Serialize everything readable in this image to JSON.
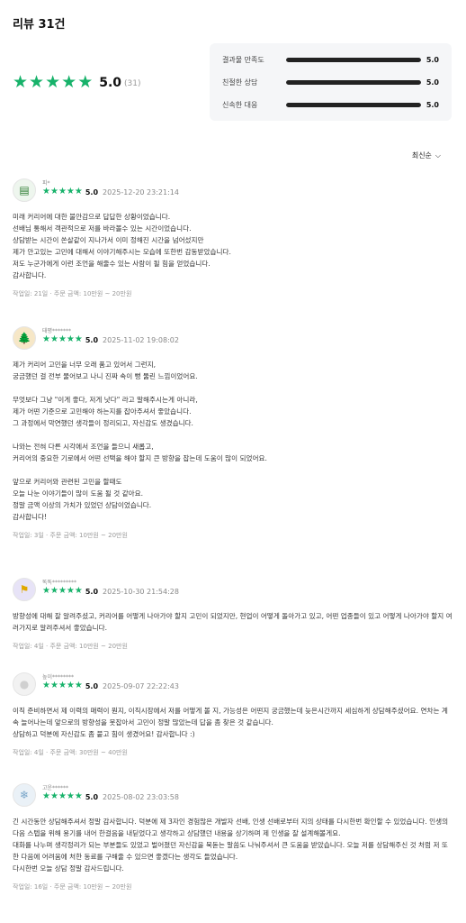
{
  "page": {
    "title": "리뷰 31건",
    "sort_label": "최신순"
  },
  "summary": {
    "rating": "5.0",
    "count": "(31)",
    "stars": 5
  },
  "breakdown": [
    {
      "label": "결과물 만족도",
      "value": "5.0",
      "fraction": 1.0
    },
    {
      "label": "친절한 상담",
      "value": "5.0",
      "fraction": 1.0
    },
    {
      "label": "신속한 대응",
      "value": "5.0",
      "fraction": 1.0
    }
  ],
  "reviews": [
    {
      "nickname": "피*",
      "avatar_icon": "card-icon",
      "score": "5.0",
      "date": "2025-12-20 23:21:14",
      "body": [
        "미래 커리어에 대한 불안감으로 답답한 상황이었습니다.",
        "선배님 통해서 객관적으로 저를 바라볼수 있는 시간이었습니다.",
        "상담받는 시간이 쏜살같이 지나가서 이미 정해진 시간을 넘어섰지만",
        "제가 안고있는 고민에 대해서 이야기해주시는 모습에 또한번 감동받았습니다.",
        "저도 누군가에게 이런 조언을 해줄수 있는 사람이 될 힘을 얻었습니다.",
        "감사합니다."
      ],
      "footer": "작업일: 21일 · 주문 금액: 10만원 ~ 20만원"
    },
    {
      "nickname": "태평*******",
      "avatar_icon": "tree-icon",
      "score": "5.0",
      "date": "2025-11-02 19:08:02",
      "body": [
        "제가 커리어 고민을 너무 오래 품고 있어서 그런지,",
        "궁금했던 걸 전부 물어보고 나니 진짜 속이 뻥 뚫린 느낌이었어요.",
        "",
        "무엇보다 그냥 \"이게 좋다, 저게 낫다\" 라고 말해주시는게 아니라,",
        "제가 어떤 기준으로 고민해야 하는지를 잡아주셔서 좋았습니다.",
        "그 과정에서 막연했던 생각들이 정리되고, 자신감도 생겼습니다.",
        "",
        "나와는 전혀 다른 시각에서 조언을 들으니 새롭고,",
        "커리어의 중요한 기로에서 어떤 선택을 해야 할지 큰 방향을 잡는데 도움이 많이 되었어요.",
        "",
        "앞으로 커리어와 관련된 고민을 할때도",
        "오늘 나눈 이야기들이 많이 도움 될 것 같아요.",
        "정말 금액 이상의 가치가 있었던 상담이었습니다.",
        "감사합니다!"
      ],
      "footer": "작업일: 3일 · 주문 금액: 10만원 ~ 20만원"
    },
    {
      "nickname": "똑똑*********",
      "avatar_icon": "flag-icon",
      "score": "5.0",
      "date": "2025-10-30 21:54:28",
      "body": [
        "방향성에 대해 잘 알려주셨고, 커리어를 어떻게 나아가야 할지 고민이 되었지만, 현업이 어떻게 돌아가고 있고, 어떤 업종들이 있고 어떻게 나아가야 할지 여러가지로 알려주셔서 좋았습니다."
      ],
      "footer": "작업일: 4일 · 주문 금액: 10만원 ~ 20만원"
    },
    {
      "nickname": "높이********",
      "avatar_icon": "user-icon",
      "score": "5.0",
      "date": "2025-09-07 22:22:43",
      "body": [
        "이직 준비하면서 제 이력의 매력이 뭔지, 이직시장에서 저를 어떻게 볼 지, 가능성은 어떤지 궁금했는데 늦은시간까지 세심하게 상담해주셨어요. 연차는 계속 늘어나는데 앞으로의 방향성을 못잡아서 고민이 정말 많았는데 답을 좀 찾은 것 같습니다.",
        "상담하고 덕분에 자신감도 좀 붙고 힘이 생겼어요! 감사합니다 :)"
      ],
      "footer": "작업일: 4일 · 주문 금액: 30만원 ~ 40만원"
    },
    {
      "nickname": "고운******",
      "avatar_icon": "snowflake-icon",
      "score": "5.0",
      "date": "2025-08-02 23:03:58",
      "body": [
        "긴 시간동안 상담해주셔서 정말 감사합니다. 덕분에 제 3자인 경험많은 개발자 선배, 인생 선배로부터 지의 상태를 다시한번 확인할 수 있었습니다. 인생의 다음 스텝을 위해 용기를 내어 한걸음을 내딛었다고 생각하고 상담했던 내용을 상기하며 제 인생을 잘 설계해볼게요.",
        "대화를 나누며 생각정리가 되는 부분들도 있었고 벌어졌던 자신감을 북돋는 말씀도 나눠주셔서 큰 도움을 받았습니다. 오늘 저를 상담해주신 것 처럼 저 또한 다음에 어려움에 처한 동료를 구해줄 수 있으면 좋겠다는 생각도 들었습니다.",
        "다시한번 오늘 상담 정말 감사드립니다."
      ],
      "footer": "작업일: 16일 · 주문 금액: 10만원 ~ 20만원"
    }
  ],
  "colors": {
    "star": "#17b26a",
    "bar_fill": "#222222",
    "bar_track": "#e3e5e8",
    "panel_bg": "#f5f6f8"
  }
}
